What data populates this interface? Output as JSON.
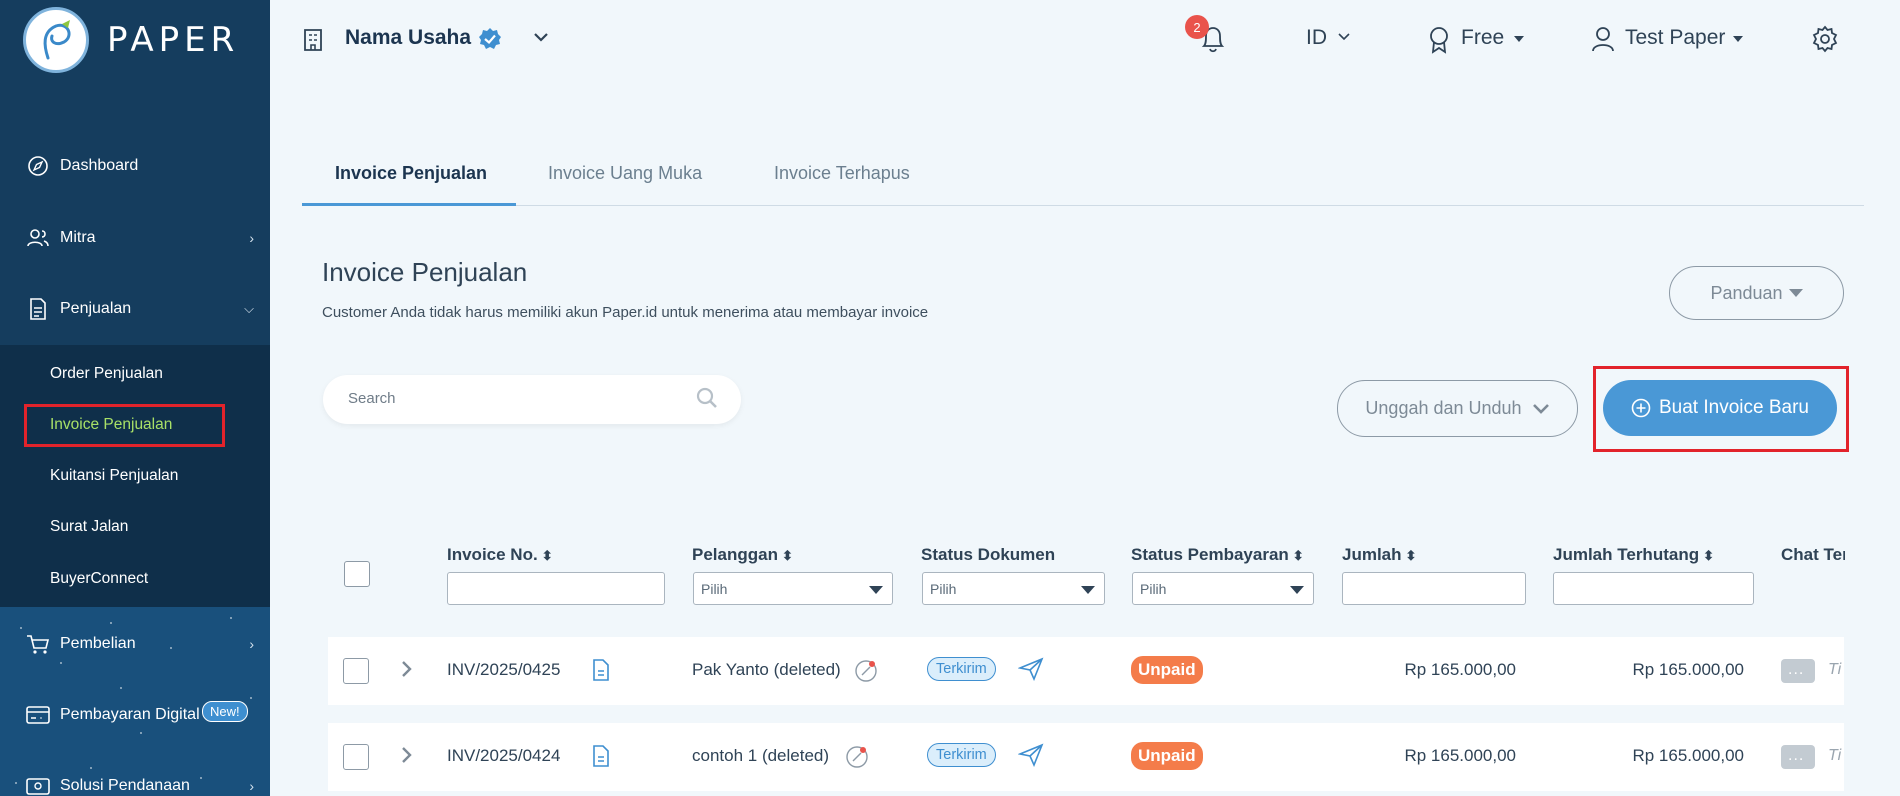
{
  "brand": {
    "name": "PAPER"
  },
  "sidebar": {
    "items": [
      {
        "label": "Dashboard",
        "icon": "compass-icon"
      },
      {
        "label": "Mitra",
        "icon": "users-icon"
      },
      {
        "label": "Penjualan",
        "icon": "document-icon"
      },
      {
        "label": "Pembelian",
        "icon": "cart-icon"
      },
      {
        "label": "Pembayaran Digital",
        "icon": "card-icon",
        "badge": "New!"
      },
      {
        "label": "Solusi Pendanaan",
        "icon": "wallet-icon"
      }
    ],
    "penjualan_sub": [
      {
        "label": "Order Penjualan"
      },
      {
        "label": "Invoice Penjualan",
        "active": true
      },
      {
        "label": "Kuitansi Penjualan"
      },
      {
        "label": "Surat Jalan"
      },
      {
        "label": "BuyerConnect"
      }
    ]
  },
  "topbar": {
    "business_name": "Nama Usaha",
    "notification_count": "2",
    "language": "ID",
    "plan": "Free",
    "user": "Test Paper"
  },
  "tabs": [
    {
      "label": "Invoice Penjualan",
      "active": true
    },
    {
      "label": "Invoice Uang Muka"
    },
    {
      "label": "Invoice Terhapus"
    }
  ],
  "page": {
    "title": "Invoice Penjualan",
    "subtitle": "Customer Anda tidak harus memiliki akun Paper.id untuk menerima atau membayar invoice",
    "guide_button": "Panduan",
    "search_placeholder": "Search",
    "upload_button": "Unggah dan Unduh",
    "create_button": "Buat Invoice Baru"
  },
  "table": {
    "columns": {
      "invoice_no": "Invoice No.",
      "customer": "Pelanggan",
      "doc_status": "Status Dokumen",
      "pay_status": "Status Pembayaran",
      "amount": "Jumlah",
      "owed": "Jumlah Terhutang",
      "chat": "Chat Ter"
    },
    "filter_placeholder": "Pilih",
    "rows": [
      {
        "invoice_no": "INV/2025/0425",
        "customer": "Pak Yanto (deleted)",
        "doc_status": "Terkirim",
        "pay_status": "Unpaid",
        "amount": "Rp 165.000,00",
        "owed": "Rp 165.000,00",
        "chat": "Ti"
      },
      {
        "invoice_no": "INV/2025/0424",
        "customer": "contoh 1 (deleted)",
        "doc_status": "Terkirim",
        "pay_status": "Unpaid",
        "amount": "Rp 165.000,00",
        "owed": "Rp 165.000,00",
        "chat": "Ti"
      }
    ]
  },
  "colors": {
    "sidebar": "#153d5e",
    "accent": "#4a98d6",
    "active_sub": "#a8e067",
    "unpaid": "#f47c4a",
    "highlight": "#e2232b"
  }
}
